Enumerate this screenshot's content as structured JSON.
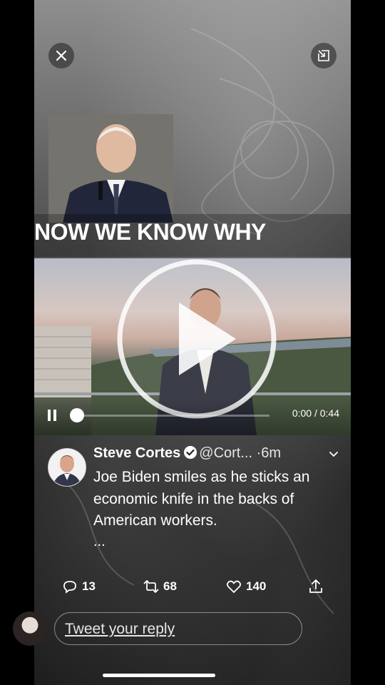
{
  "meme": {
    "caption": "NOW WE KNOW WHY"
  },
  "video": {
    "time_display": "0:00 / 0:44",
    "progress": 0.0
  },
  "tweet": {
    "author_name": "Steve Cortes",
    "author_handle": "@Cort...",
    "separator": "·",
    "time_ago": "6m",
    "text": "Joe Biden smiles as he sticks an economic knife in the backs of American workers.",
    "ellipsis": "...",
    "reply_count": "13",
    "retweet_count": "68",
    "like_count": "140"
  },
  "reply_bar": {
    "placeholder": "Tweet your reply"
  },
  "icons": {
    "close": "close-icon",
    "minimize": "minimize-icon",
    "play": "play-icon",
    "pause": "pause-icon",
    "verified": "verified-badge-icon",
    "more": "chevron-down-icon",
    "reply": "reply-icon",
    "retweet": "retweet-icon",
    "like": "heart-icon",
    "share": "share-icon"
  },
  "colors": {
    "background": "#000000",
    "text": "#ffffff"
  }
}
